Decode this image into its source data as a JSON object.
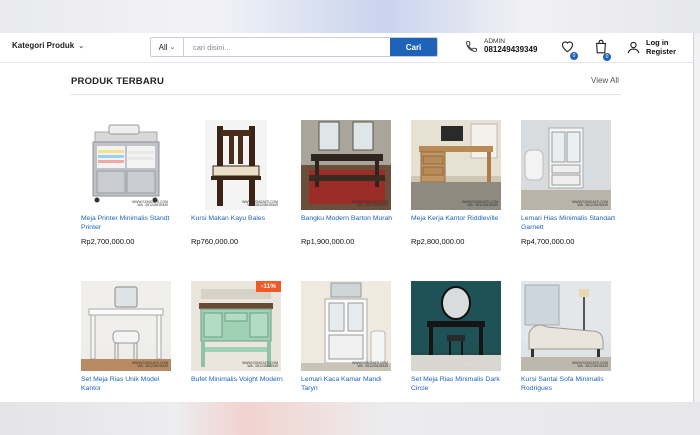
{
  "header": {
    "kategori_label": "Kategori Produk",
    "search": {
      "category": "All",
      "placeholder": "cari disini...",
      "button_label": "Cari"
    },
    "contact": {
      "label": "ADMIN",
      "phone": "081249439349"
    },
    "wishlist_count": "0",
    "cart_count": "0",
    "account": {
      "login": "Log in",
      "register": "Register"
    }
  },
  "section": {
    "title": "PRODUK TERBARU",
    "view_all": "View All"
  },
  "watermark": {
    "site": "WWW.SONOJATI.COM",
    "wa": "WA : 081249439349"
  },
  "colors": {
    "accent": "#1e63b8",
    "discount": "#f05a28"
  },
  "products": [
    {
      "name": "Meja Printer Minimalis Standt Printer",
      "price": "Rp2,700,000.00"
    },
    {
      "name": "Kursi Makan Kayu Bales",
      "price": "Rp760,000.00"
    },
    {
      "name": "Bangku Modern Barton Murah",
      "price": "Rp1,900,000.00"
    },
    {
      "name": "Meja Kerja Kantor Riddleville",
      "price": "Rp2,800,000.00"
    },
    {
      "name": "Lemari Hias Minimalis Standart Garnett",
      "price": "Rp4,700,000.00"
    },
    {
      "name": "Set Meja Rias Unik Model Kantor",
      "price": ""
    },
    {
      "name": "Bufet Minimalis Voight Modern",
      "price": "",
      "discount": "-11%"
    },
    {
      "name": "Lemari Kaca Kamar Mandi Taryn",
      "price": ""
    },
    {
      "name": "Set Meja Rias Minimalis Dark Circle",
      "price": ""
    },
    {
      "name": "Kursi Santai Sofa Minimalis Rodrigues",
      "price": ""
    }
  ]
}
